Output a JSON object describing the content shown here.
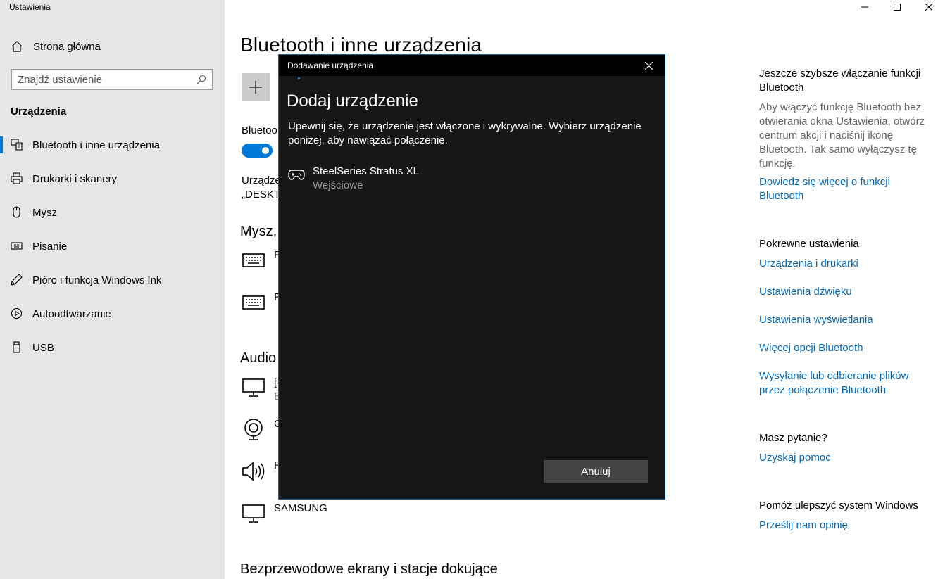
{
  "window": {
    "title": "Ustawienia",
    "controls": [
      "minimize-icon",
      "maximize-icon",
      "close-icon"
    ]
  },
  "sidebar": {
    "home_label": "Strona główna",
    "search_placeholder": "Znajdź ustawienie",
    "section_label": "Urządzenia",
    "items": [
      {
        "label": "Bluetooth i inne urządzenia",
        "icon": "bluetooth-devices-icon",
        "active": true
      },
      {
        "label": "Drukarki i skanery",
        "icon": "printer-icon"
      },
      {
        "label": "Mysz",
        "icon": "mouse-icon"
      },
      {
        "label": "Pisanie",
        "icon": "keyboard-icon"
      },
      {
        "label": "Pióro i funkcja Windows Ink",
        "icon": "pen-icon"
      },
      {
        "label": "Autoodtwarzanie",
        "icon": "autoplay-icon"
      },
      {
        "label": "USB",
        "icon": "usb-icon"
      }
    ]
  },
  "main": {
    "title": "Bluetooth i inne urządzenia",
    "bluetooth_label": "Bluetoo",
    "discoverable_line1": "Urządze",
    "discoverable_line2": "„DESKTO",
    "group_mouse": "Mysz,",
    "group_audio": "Audio",
    "group_wireless": "Bezprzewodowe ekrany i stacje dokujące",
    "devices": [
      {
        "name": "R",
        "icon": "keyboard-icon"
      },
      {
        "name": "R",
        "icon": "keyboard-icon"
      },
      {
        "name": "[",
        "sub": "E",
        "icon": "monitor-icon"
      },
      {
        "name": "C",
        "icon": "webcam-icon"
      },
      {
        "name": "R",
        "icon": "speaker-icon"
      },
      {
        "name": "SAMSUNG",
        "icon": "monitor-icon"
      }
    ]
  },
  "right_pane": {
    "quick_head": "Jeszcze szybsze włączanie funkcji Bluetooth",
    "quick_text": "Aby włączyć funkcję Bluetooth bez otwierania okna Ustawienia, otwórz centrum akcji i naciśnij ikonę Bluetooth. Tak samo wyłączysz tę funkcję.",
    "quick_link": "Dowiedz się więcej o funkcji Bluetooth",
    "related_head": "Pokrewne ustawienia",
    "related_links": [
      "Urządzenia i drukarki",
      "Ustawienia dźwięku",
      "Ustawienia wyświetlania",
      "Więcej opcji Bluetooth",
      "Wysyłanie lub odbieranie plików przez połączenie Bluetooth"
    ],
    "question_head": "Masz pytanie?",
    "question_link": "Uzyskaj pomoc",
    "improve_head": "Pomóż ulepszyć system Windows",
    "improve_link": "Prześlij nam opinię"
  },
  "dialog": {
    "window_title": "Dodawanie urządzenia",
    "heading": "Dodaj urządzenie",
    "description": "Upewnij się, że urządzenie jest włączone i wykrywalne. Wybierz urządzenie poniżej, aby nawiązać połączenie.",
    "device_name": "SteelSeries Stratus XL",
    "device_type": "Wejściowe",
    "device_icon": "gamepad-icon",
    "cancel_label": "Anuluj"
  },
  "colors": {
    "accent": "#0078d7",
    "link": "#0067b8",
    "sidebar_bg": "#e6e6e6",
    "dialog_bg": "#171717"
  }
}
